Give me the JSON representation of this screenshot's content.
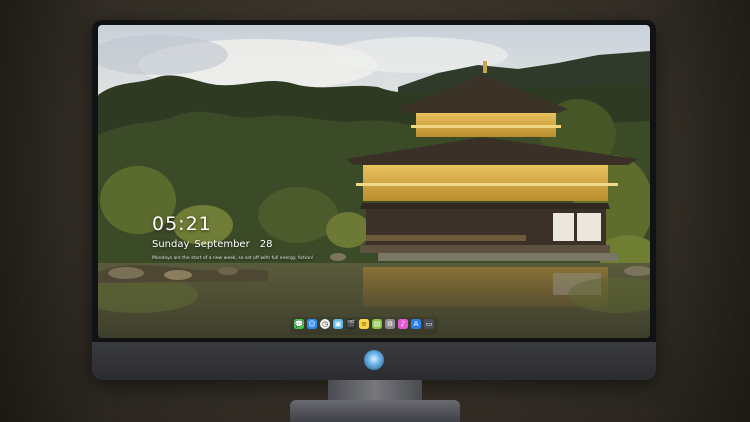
{
  "lockscreen": {
    "time": "05:21",
    "weekday": "Sunday",
    "month": "September",
    "day": "28",
    "memo": "Mondays are the start of a new week, so set off with full energy. Action!"
  },
  "dock": {
    "items": [
      {
        "name": "messages-icon",
        "color": "#3ec94f",
        "glyph": "💬"
      },
      {
        "name": "finder-icon",
        "color": "#2f8ef0",
        "glyph": "☺"
      },
      {
        "name": "clock-icon",
        "color": "#f2f2f2",
        "glyph": "◷"
      },
      {
        "name": "preview-icon",
        "color": "#5fb7e8",
        "glyph": "▣"
      },
      {
        "name": "claquette-icon",
        "color": "#2b2b2b",
        "glyph": "🎬"
      },
      {
        "name": "notes-icon",
        "color": "#f7d64a",
        "glyph": "≡"
      },
      {
        "name": "photos-icon",
        "color": "#8bc34a",
        "glyph": "▤"
      },
      {
        "name": "settings-icon",
        "color": "#8e8e93",
        "glyph": "⚙"
      },
      {
        "name": "itunes-icon",
        "color": "#e25bd2",
        "glyph": "♪"
      },
      {
        "name": "appstore-icon",
        "color": "#2b7fe8",
        "glyph": "A"
      },
      {
        "name": "screen-icon",
        "color": "#4a4f57",
        "glyph": "▭"
      }
    ]
  }
}
